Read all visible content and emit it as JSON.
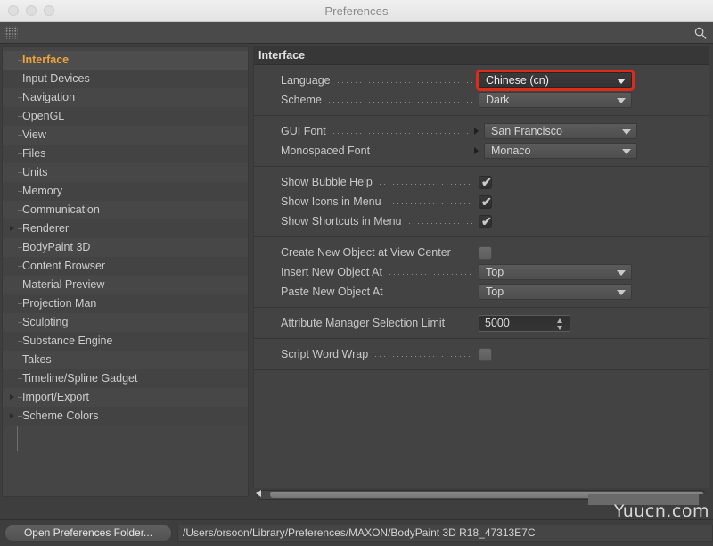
{
  "window": {
    "title": "Preferences",
    "traffic_lights": [
      "close",
      "minimize",
      "zoom"
    ]
  },
  "toolbar": {
    "grip_icon": "drag-grip-icon",
    "search_icon": "search-icon"
  },
  "sidebar": {
    "items": [
      {
        "label": "Interface",
        "selected": true,
        "expandable": false
      },
      {
        "label": "Input Devices",
        "selected": false,
        "expandable": false
      },
      {
        "label": "Navigation",
        "selected": false,
        "expandable": false
      },
      {
        "label": "OpenGL",
        "selected": false,
        "expandable": false
      },
      {
        "label": "View",
        "selected": false,
        "expandable": false
      },
      {
        "label": "Files",
        "selected": false,
        "expandable": false
      },
      {
        "label": "Units",
        "selected": false,
        "expandable": false
      },
      {
        "label": "Memory",
        "selected": false,
        "expandable": false
      },
      {
        "label": "Communication",
        "selected": false,
        "expandable": false
      },
      {
        "label": "Renderer",
        "selected": false,
        "expandable": true
      },
      {
        "label": "BodyPaint 3D",
        "selected": false,
        "expandable": false
      },
      {
        "label": "Content Browser",
        "selected": false,
        "expandable": false
      },
      {
        "label": "Material Preview",
        "selected": false,
        "expandable": false
      },
      {
        "label": "Projection Man",
        "selected": false,
        "expandable": false
      },
      {
        "label": "Sculpting",
        "selected": false,
        "expandable": false
      },
      {
        "label": "Substance Engine",
        "selected": false,
        "expandable": false
      },
      {
        "label": "Takes",
        "selected": false,
        "expandable": false
      },
      {
        "label": "Timeline/Spline Gadget",
        "selected": false,
        "expandable": false
      },
      {
        "label": "Import/Export",
        "selected": false,
        "expandable": true
      },
      {
        "label": "Scheme Colors",
        "selected": false,
        "expandable": true
      }
    ]
  },
  "panel": {
    "header": "Interface",
    "groups": [
      {
        "rows": [
          {
            "label": "Language",
            "type": "dropdown",
            "value": "Chinese (cn)",
            "highlighted": true,
            "submenu": false
          },
          {
            "label": "Scheme",
            "type": "dropdown",
            "value": "Dark",
            "highlighted": false,
            "submenu": false
          }
        ]
      },
      {
        "rows": [
          {
            "label": "GUI Font",
            "type": "dropdown",
            "value": "San Francisco",
            "highlighted": false,
            "submenu": true
          },
          {
            "label": "Monospaced Font",
            "type": "dropdown",
            "value": "Monaco",
            "highlighted": false,
            "submenu": true
          }
        ]
      },
      {
        "rows": [
          {
            "label": "Show Bubble Help",
            "type": "checkbox",
            "checked": true
          },
          {
            "label": "Show Icons in Menu",
            "type": "checkbox",
            "checked": true
          },
          {
            "label": "Show Shortcuts in Menu",
            "type": "checkbox",
            "checked": true
          }
        ]
      },
      {
        "rows": [
          {
            "label": "Create New Object at View Center",
            "type": "checkbox",
            "checked": false,
            "nodots": true
          },
          {
            "label": "Insert New Object At",
            "type": "dropdown",
            "value": "Top",
            "highlighted": false,
            "submenu": false
          },
          {
            "label": "Paste New Object At",
            "type": "dropdown",
            "value": "Top",
            "highlighted": false,
            "submenu": false
          }
        ]
      },
      {
        "rows": [
          {
            "label": "Attribute Manager Selection Limit",
            "type": "stepper",
            "value": "5000",
            "nodots": true
          }
        ]
      },
      {
        "rows": [
          {
            "label": "Script Word Wrap",
            "type": "checkbox",
            "checked": false
          }
        ]
      }
    ]
  },
  "bottom": {
    "open_folder_label": "Open Preferences Folder...",
    "path": "/Users/orsoon/Library/Preferences/MAXON/BodyPaint 3D R18_47313E7C"
  },
  "watermark": {
    "text": "Yuucn.com"
  },
  "colors": {
    "accent_selected": "#f0a33c",
    "highlight_border": "#e02b1a",
    "panel_bg": "#434343",
    "sidebar_bg": "#454545",
    "window_bg": "#3e3e3e"
  }
}
